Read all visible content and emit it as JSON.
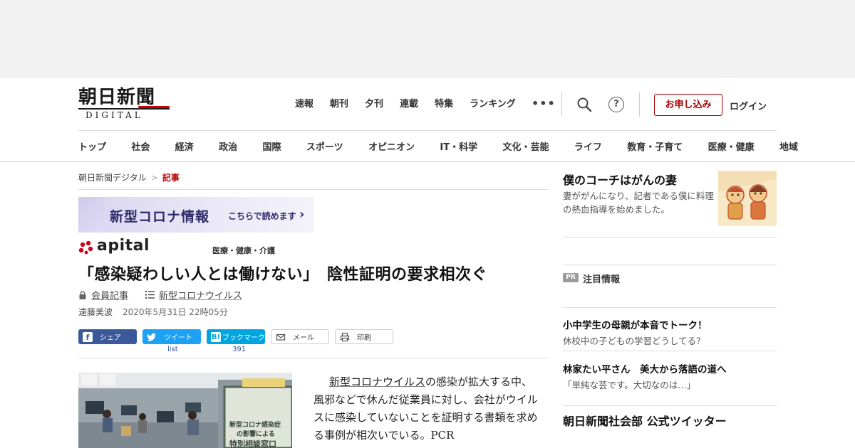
{
  "header": {
    "logo_jp": "朝日新聞",
    "logo_en": "DIGITAL",
    "top_nav": [
      "速報",
      "朝刊",
      "夕刊",
      "連載",
      "特集",
      "ランキング"
    ],
    "more": "•••",
    "help_icon_glyph": "?",
    "signup_label": "お申し込み",
    "login_label": "ログイン",
    "categories": [
      "トップ",
      "社会",
      "経済",
      "政治",
      "国際",
      "スポーツ",
      "オピニオン",
      "IT・科学",
      "文化・芸能",
      "ライフ",
      "教育・子育て",
      "医療・健康",
      "地域"
    ]
  },
  "breadcrumb": {
    "home": "朝日新聞デジタル",
    "sep": ">",
    "current": "記事"
  },
  "banner": {
    "title": "新型コロナ情報",
    "cta": "こちらで読めます",
    "chevron": "›"
  },
  "section": {
    "brand": "apital",
    "category": "医療・健康・介護"
  },
  "article": {
    "title": "「感染疑わしい人とは働けない」　陰性証明の要求相次ぐ",
    "member_label": "会員記事",
    "topic_label": "新型コロナウイルス",
    "author": "遠藤美波",
    "date": "2020年5月31日 22時05分",
    "share": {
      "facebook": "シェア",
      "twitter": "ツイート",
      "hatena": "ブックマーク",
      "mail": "メール",
      "print": "印刷",
      "twitter_count": "list",
      "hatena_count": "391"
    },
    "photo_sign_lines": [
      "新型コロナ感染症",
      "の影響による",
      "特別相談窓口"
    ],
    "body_link": "新型コロナウイルス",
    "body_1": "の感染が拡大する中、風邪などで休んだ従業員に対し、会社がウイルスに感染していないことを証明する書類を求める事例が相次いでいる。PCR"
  },
  "sidebar": {
    "feature_title": "僕のコーチはがんの妻",
    "feature_desc": "妻ががんになり、記者である僕に料理の熱血指導を始めました。",
    "pr_badge": "PR",
    "pr_label": "注目情報",
    "items": [
      {
        "title": "小中学生の母親が本音でトーク！",
        "desc": "休校中の子どもの学習どうしてる？"
      },
      {
        "title": "林家たい平さん　美大から落語の道へ",
        "desc": "「単純な芸です。大切なのは…」"
      }
    ],
    "twitter_title": "朝日新聞社会部 公式ツイッター"
  },
  "colors": {
    "brand_red": "#b00000",
    "facebook": "#3b5998",
    "twitter": "#1da1f2",
    "hatena": "#00a4de",
    "covid_banner": "#2f2a6a"
  }
}
